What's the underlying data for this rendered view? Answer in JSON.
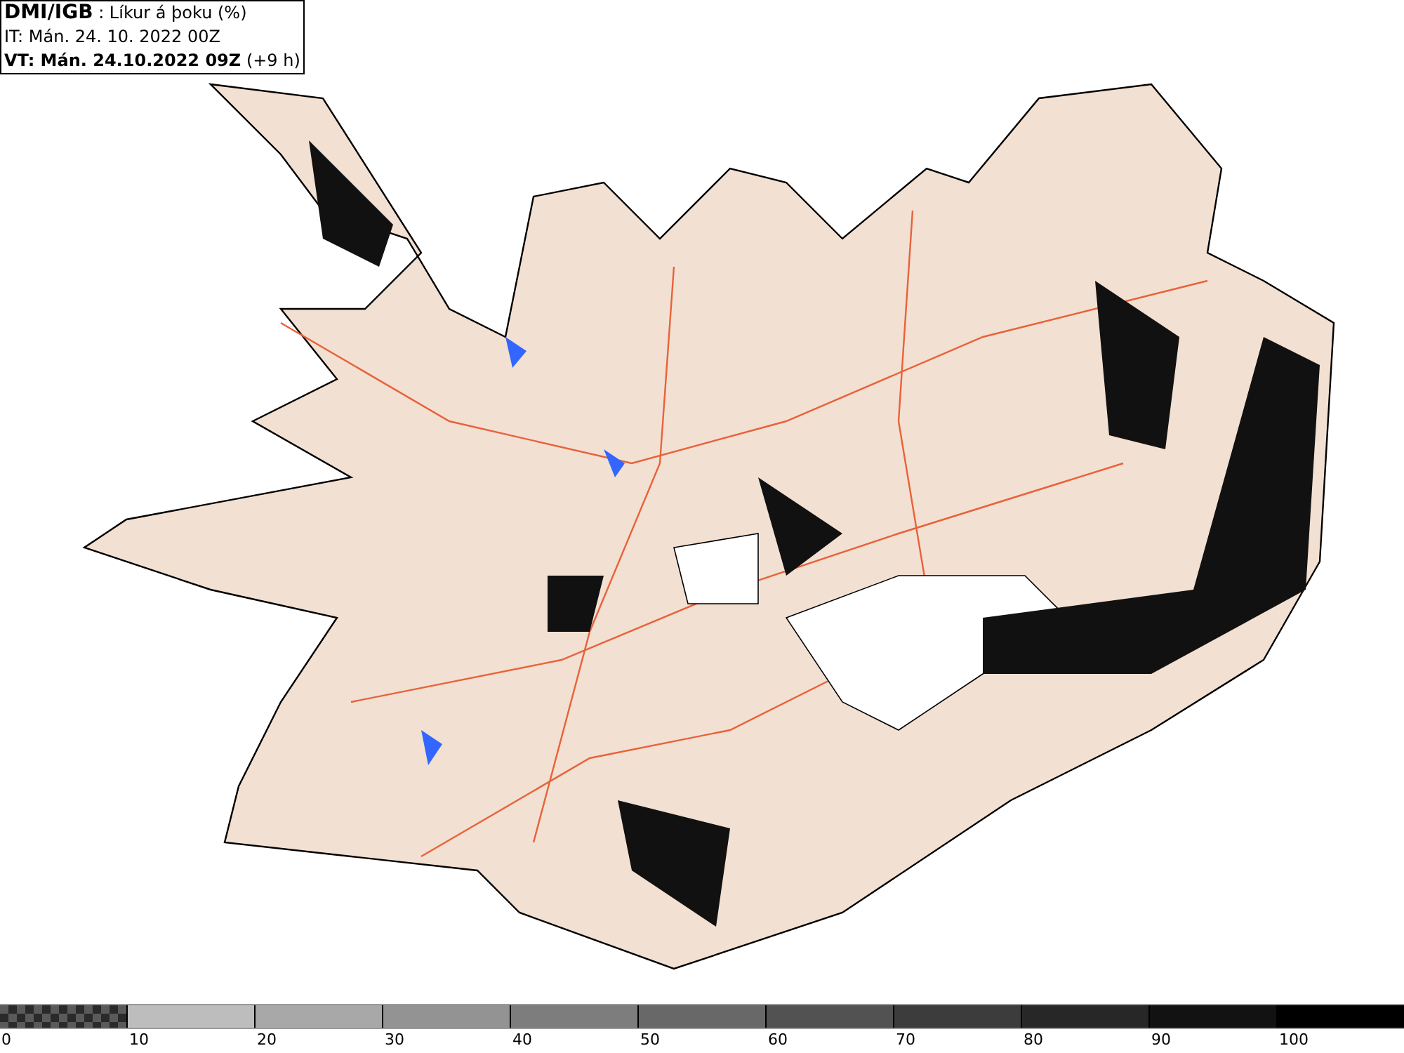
{
  "header": {
    "source": "DMI/IGB",
    "title": " : Líkur á þoku (%)",
    "issue": "IT: Mán. 24. 10. 2022 00Z",
    "valid": "VT: Mán. 24.10.2022 09Z",
    "valid_offset": "(+9 h)"
  },
  "legend": {
    "bins": [
      {
        "kind": "checker"
      },
      {
        "kind": "solid",
        "color": "#bdbdbd"
      },
      {
        "kind": "solid",
        "color": "#a8a8a8"
      },
      {
        "kind": "solid",
        "color": "#939393"
      },
      {
        "kind": "solid",
        "color": "#7d7d7d"
      },
      {
        "kind": "solid",
        "color": "#686868"
      },
      {
        "kind": "solid",
        "color": "#525252"
      },
      {
        "kind": "solid",
        "color": "#3c3c3c"
      },
      {
        "kind": "solid",
        "color": "#272727"
      },
      {
        "kind": "solid",
        "color": "#121212"
      },
      {
        "kind": "solid",
        "color": "#000000"
      }
    ],
    "labels": [
      "0",
      "10",
      "20",
      "30",
      "40",
      "50",
      "60",
      "70",
      "80",
      "90",
      "100"
    ]
  }
}
